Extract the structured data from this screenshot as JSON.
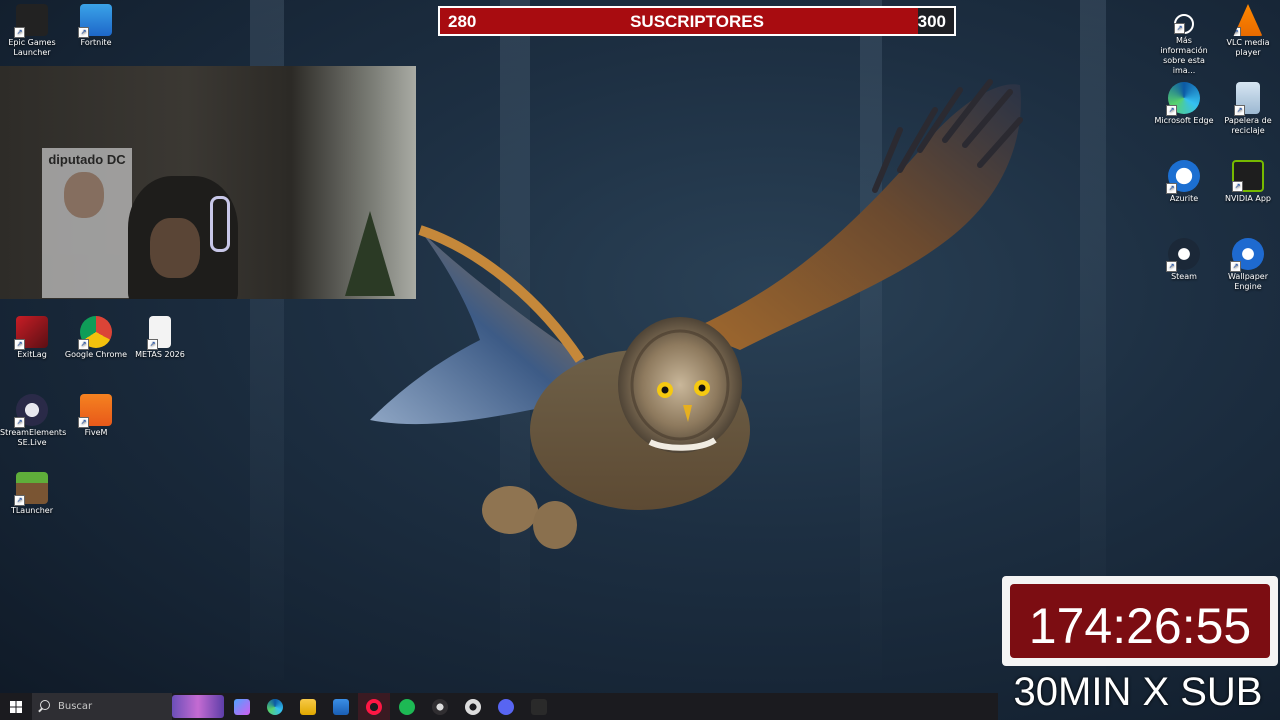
{
  "subscribers": {
    "current": "280",
    "label": "SUSCRIPTORES",
    "goal": "300",
    "progress": 0.93
  },
  "timer": {
    "value": "174:26:55",
    "promo": "30MIN X SUB"
  },
  "desktop_icons_left": [
    {
      "label": "Epic Games Launcher",
      "icon": "epic-games-icon"
    },
    {
      "label": "Fortnite",
      "icon": "fortnite-icon"
    },
    {
      "label": "ExitLag",
      "icon": "exitlag-icon"
    },
    {
      "label": "Google Chrome",
      "icon": "chrome-icon"
    },
    {
      "label": "METAS 2026",
      "icon": "document-icon"
    },
    {
      "label": "StreamElements SE.Live",
      "icon": "streamelements-icon"
    },
    {
      "label": "FiveM",
      "icon": "fivem-icon"
    },
    {
      "label": "TLauncher",
      "icon": "tlauncher-icon"
    }
  ],
  "desktop_icons_right": [
    {
      "label": "Más información sobre esta ima...",
      "icon": "info-camera-icon"
    },
    {
      "label": "VLC media player",
      "icon": "vlc-icon"
    },
    {
      "label": "Microsoft Edge",
      "icon": "edge-icon"
    },
    {
      "label": "Papelera de reciclaje",
      "icon": "recycle-bin-icon"
    },
    {
      "label": "Azurite",
      "icon": "azurite-icon"
    },
    {
      "label": "NVIDIA App",
      "icon": "nvidia-icon"
    },
    {
      "label": "Steam",
      "icon": "steam-icon"
    },
    {
      "label": "Wallpaper Engine",
      "icon": "wallpaper-engine-icon"
    }
  ],
  "taskbar": {
    "search_placeholder": "Buscar",
    "apps": [
      "copilot-icon",
      "edge-icon",
      "file-explorer-icon",
      "mail-icon",
      "opera-gx-icon",
      "spotify-icon",
      "obs-icon",
      "settings-icon",
      "discord-icon",
      "epic-games-icon"
    ]
  },
  "webcam": {
    "poster_text": "diputado DC"
  },
  "colors": {
    "bar_fill": "#a80c10",
    "timer_bg": "#7c0d12",
    "taskbar": "#1b1b1f"
  }
}
